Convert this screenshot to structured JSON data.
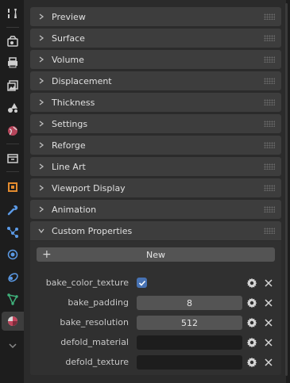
{
  "tabs": [
    {
      "icon": "tool-icon",
      "active": false
    },
    {
      "icon": "render-icon",
      "active": false
    },
    {
      "icon": "output-icon",
      "active": false
    },
    {
      "icon": "view-layer-icon",
      "active": false
    },
    {
      "icon": "scene-icon",
      "active": false
    },
    {
      "icon": "world-icon",
      "active": false
    },
    {
      "icon": "collection-icon",
      "active": false
    },
    {
      "icon": "object-icon",
      "active": false
    },
    {
      "icon": "modifier-wrench-icon",
      "active": false
    },
    {
      "icon": "particles-icon",
      "active": false
    },
    {
      "icon": "physics-icon",
      "active": false
    },
    {
      "icon": "constraints-icon",
      "active": false
    },
    {
      "icon": "data-icon",
      "active": false
    },
    {
      "icon": "material-icon",
      "active": true
    },
    {
      "icon": "expand-chevron-icon",
      "active": false
    }
  ],
  "panels": [
    {
      "label": "Preview",
      "expanded": false
    },
    {
      "label": "Surface",
      "expanded": false
    },
    {
      "label": "Volume",
      "expanded": false
    },
    {
      "label": "Displacement",
      "expanded": false
    },
    {
      "label": "Thickness",
      "expanded": false
    },
    {
      "label": "Settings",
      "expanded": false
    },
    {
      "label": "Reforge",
      "expanded": false
    },
    {
      "label": "Line Art",
      "expanded": false
    },
    {
      "label": "Viewport Display",
      "expanded": false
    },
    {
      "label": "Animation",
      "expanded": false
    },
    {
      "label": "Custom Properties",
      "expanded": true
    }
  ],
  "custom_properties": {
    "new_button_label": "New",
    "items": [
      {
        "name": "bake_color_texture",
        "type": "bool",
        "value": true
      },
      {
        "name": "bake_padding",
        "type": "int",
        "value": "8"
      },
      {
        "name": "bake_resolution",
        "type": "int",
        "value": "512"
      },
      {
        "name": "defold_material",
        "type": "string",
        "value": ""
      },
      {
        "name": "defold_texture",
        "type": "string",
        "value": ""
      }
    ]
  },
  "colors": {
    "accent": "#4772b3",
    "panel_header": "#3d3d3d",
    "editor_bg": "#2b2b2b",
    "field": "#545454",
    "field_dark": "#1d1d1d"
  }
}
